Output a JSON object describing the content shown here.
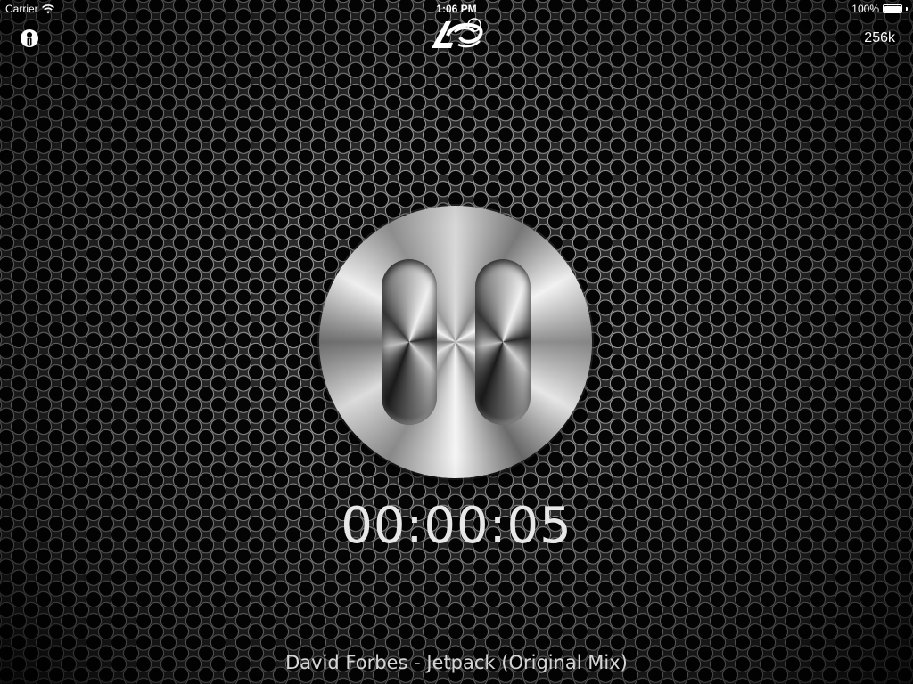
{
  "status_bar": {
    "carrier": "Carrier",
    "wifi_icon": "wifi-icon",
    "time": "1:06 PM",
    "battery_percent": "100%",
    "battery_level": 1.0
  },
  "top_bar": {
    "info_icon": "info-person-icon",
    "logo_icon": "station-logo",
    "bitrate": "256k"
  },
  "player": {
    "state": "playing",
    "control_icon": "pause-icon",
    "elapsed": "00:00:05",
    "track_title": "David Forbes - Jetpack (Original Mix)"
  },
  "colors": {
    "background": "#0a0a0a",
    "text": "#ffffff",
    "timer_text": "#e8e8e8",
    "metal": "#d8d8d8"
  }
}
